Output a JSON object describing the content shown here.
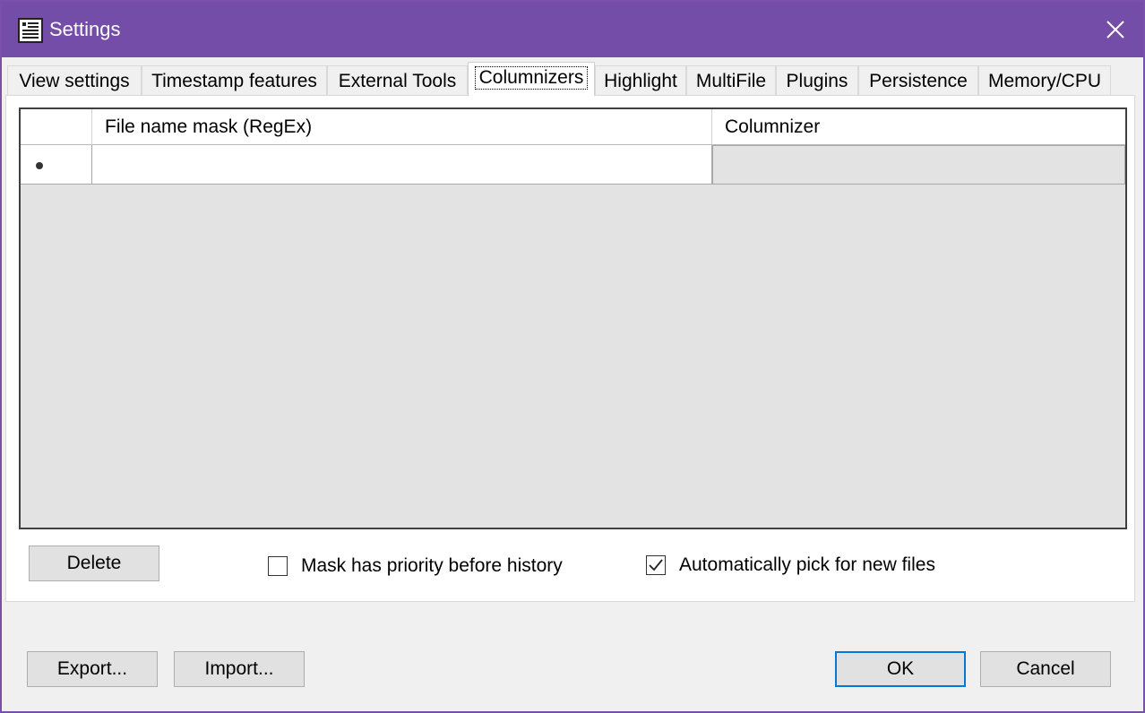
{
  "window": {
    "title": "Settings"
  },
  "tabs": [
    {
      "label": "View settings"
    },
    {
      "label": "Timestamp features"
    },
    {
      "label": "External Tools"
    },
    {
      "label": "Columnizers"
    },
    {
      "label": "Highlight"
    },
    {
      "label": "MultiFile"
    },
    {
      "label": "Plugins"
    },
    {
      "label": "Persistence"
    },
    {
      "label": "Memory/CPU"
    }
  ],
  "active_tab": "Columnizers",
  "grid": {
    "columns": [
      "File name mask (RegEx)",
      "Columnizer"
    ],
    "new_row": {
      "mask": "",
      "columnizer": ""
    }
  },
  "panel": {
    "delete_label": "Delete",
    "mask_priority": {
      "label": "Mask has priority before history",
      "checked": false
    },
    "auto_pick": {
      "label": "Automatically pick for new files",
      "checked": true
    }
  },
  "footer": {
    "export_label": "Export...",
    "import_label": "Import...",
    "ok_label": "OK",
    "cancel_label": "Cancel"
  },
  "colors": {
    "titlebar": "#744da9",
    "focus_border": "#0078d7"
  }
}
